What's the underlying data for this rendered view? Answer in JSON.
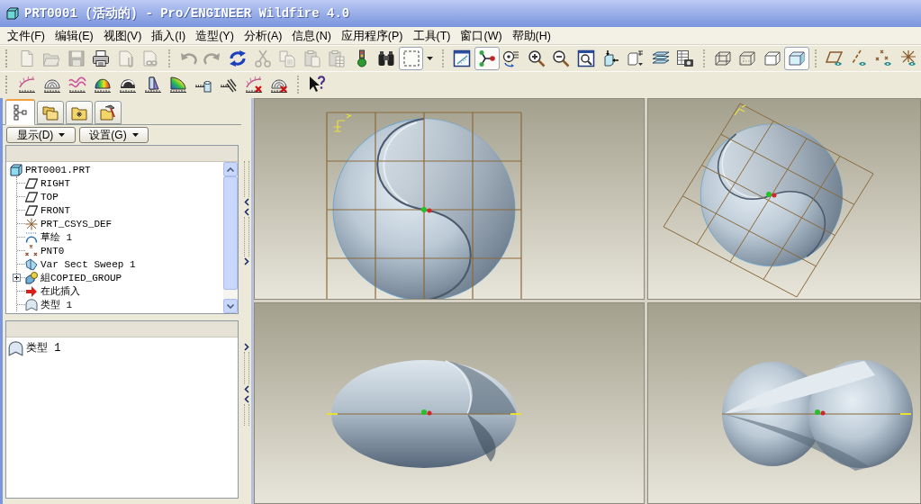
{
  "window": {
    "title": "PRT0001 (活动的) - Pro/ENGINEER Wildfire 4.0"
  },
  "menu": [
    "文件(F)",
    "编辑(E)",
    "视图(V)",
    "插入(I)",
    "造型(Y)",
    "分析(A)",
    "信息(N)",
    "应用程序(P)",
    "工具(T)",
    "窗口(W)",
    "帮助(H)"
  ],
  "toolbars": [
    {
      "groups": [
        [
          {
            "kind": "new",
            "disabled": true,
            "on": false
          },
          {
            "kind": "open",
            "disabled": true,
            "on": false
          },
          {
            "kind": "save",
            "disabled": true,
            "on": false
          },
          {
            "kind": "print",
            "disabled": false,
            "on": false
          },
          {
            "kind": "mail",
            "disabled": true,
            "on": false
          },
          {
            "kind": "mail-link",
            "disabled": true,
            "on": false
          }
        ],
        [
          {
            "kind": "undo",
            "disabled": true,
            "on": false
          },
          {
            "kind": "redo",
            "disabled": true,
            "on": false
          },
          {
            "kind": "regenerate",
            "disabled": false,
            "on": false
          },
          {
            "kind": "cut",
            "disabled": true,
            "on": false
          },
          {
            "kind": "copy",
            "disabled": true,
            "on": false
          },
          {
            "kind": "paste",
            "disabled": true,
            "on": false
          },
          {
            "kind": "paste-special",
            "disabled": true,
            "on": false
          },
          {
            "kind": "traffic-light",
            "disabled": false,
            "on": false
          },
          {
            "kind": "find",
            "disabled": false,
            "on": false
          },
          {
            "kind": "selection-filter",
            "disabled": false,
            "on": true
          }
        ],
        [
          {
            "kind": "repaint",
            "disabled": false,
            "on": false
          },
          {
            "kind": "spin-center",
            "disabled": false,
            "on": true
          },
          {
            "kind": "orient",
            "disabled": false,
            "on": false
          },
          {
            "kind": "zoom-in",
            "disabled": false,
            "on": false
          },
          {
            "kind": "zoom-out",
            "disabled": false,
            "on": false
          },
          {
            "kind": "refit",
            "disabled": false,
            "on": false
          },
          {
            "kind": "reorient",
            "disabled": false,
            "on": false
          },
          {
            "kind": "saved-views",
            "disabled": false,
            "on": false
          },
          {
            "kind": "layers",
            "disabled": false,
            "on": false
          },
          {
            "kind": "view-manager",
            "disabled": false,
            "on": false
          }
        ],
        [
          {
            "kind": "wireframe",
            "disabled": false,
            "on": false
          },
          {
            "kind": "hidden-line",
            "disabled": false,
            "on": false
          },
          {
            "kind": "no-hidden",
            "disabled": false,
            "on": false
          },
          {
            "kind": "shading",
            "disabled": false,
            "on": true
          }
        ],
        [
          {
            "kind": "datum-planes",
            "disabled": false,
            "on": false
          },
          {
            "kind": "datum-axes",
            "disabled": false,
            "on": false
          },
          {
            "kind": "datum-points",
            "disabled": false,
            "on": false
          },
          {
            "kind": "datum-csys",
            "disabled": false,
            "on": false
          }
        ]
      ]
    },
    {
      "groups": [
        [
          {
            "kind": "curvature",
            "disabled": false,
            "on": false
          },
          {
            "kind": "section",
            "disabled": false,
            "on": false
          },
          {
            "kind": "deviation",
            "disabled": false,
            "on": false
          },
          {
            "kind": "shade-curvature",
            "disabled": false,
            "on": false
          },
          {
            "kind": "reflection",
            "disabled": false,
            "on": false
          },
          {
            "kind": "draft",
            "disabled": false,
            "on": false
          },
          {
            "kind": "slope",
            "disabled": false,
            "on": false
          },
          {
            "kind": "offset",
            "disabled": false,
            "on": false
          },
          {
            "kind": "dihedral",
            "disabled": false,
            "on": false
          },
          {
            "kind": "delete-curvature",
            "disabled": false,
            "on": false
          },
          {
            "kind": "delete-all",
            "disabled": false,
            "on": false
          }
        ],
        [
          {
            "kind": "whats-this",
            "disabled": false,
            "on": false
          }
        ]
      ]
    }
  ],
  "navigator": {
    "tabs": [
      {
        "kind": "model-tree",
        "selected": true
      },
      {
        "kind": "folder-browser",
        "selected": false
      },
      {
        "kind": "favorites",
        "selected": false
      },
      {
        "kind": "connections",
        "selected": false
      }
    ],
    "buttons": [
      "显示(D)",
      "设置(G)"
    ],
    "tree": [
      {
        "label": "PRT0001.PRT",
        "kind": "part",
        "children": [
          {
            "label": "RIGHT",
            "kind": "plane"
          },
          {
            "label": "TOP",
            "kind": "plane"
          },
          {
            "label": "FRONT",
            "kind": "plane"
          },
          {
            "label": "PRT_CSYS_DEF",
            "kind": "csys"
          },
          {
            "label": "草绘 1",
            "kind": "sketch"
          },
          {
            "label": "PNT0",
            "kind": "point"
          },
          {
            "label": "Var Sect Sweep 1",
            "kind": "sweep"
          },
          {
            "label": "組COPIED_GROUP",
            "kind": "group",
            "expanded": false
          },
          {
            "label": "在此插入",
            "kind": "insert"
          },
          {
            "label": "类型 1",
            "kind": "analysis"
          }
        ]
      }
    ]
  },
  "analysis_list": [
    {
      "label": "类型 1",
      "kind": "analysis"
    }
  ],
  "viewports": [
    {
      "kind": "front"
    },
    {
      "kind": "rotated"
    },
    {
      "kind": "top"
    },
    {
      "kind": "side"
    }
  ]
}
